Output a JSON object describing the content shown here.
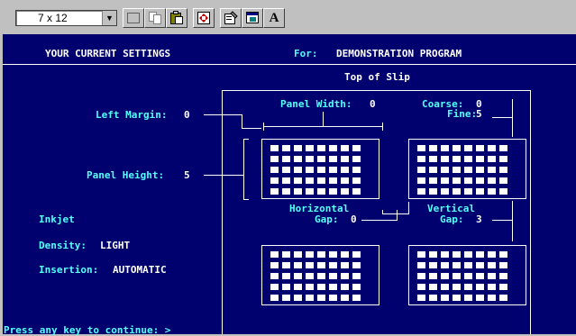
{
  "toolbar": {
    "font_size": "7 x 12",
    "font_button_label": "A"
  },
  "screen": {
    "header_left": "YOUR CURRENT SETTINGS",
    "header_for_label": "For:",
    "header_program": "DEMONSTRATION PROGRAM",
    "top_of_slip": "Top of Slip",
    "left_margin_label": "Left Margin:",
    "left_margin_value": "0",
    "panel_height_label": "Panel Height:",
    "panel_height_value": "5",
    "panel_width_label": "Panel Width:",
    "panel_width_value": "0",
    "coarse_label": "Coarse:",
    "coarse_value": "0",
    "fine_label": "Fine:",
    "fine_value": "5",
    "horizontal_label": "Horizontal",
    "horizontal_gap_label": "Gap:",
    "horizontal_gap_value": "0",
    "vertical_label": "Vertical",
    "vertical_gap_label": "Gap:",
    "vertical_gap_value": "3",
    "printer_type": "Inkjet",
    "density_label": "Density:",
    "density_value": "LIGHT",
    "insertion_label": "Insertion:",
    "insertion_value": "AUTOMATIC",
    "prompt": "Press any key to continue: >"
  },
  "colors": {
    "screen_background": "#00006e",
    "label_cyan": "#55ffff",
    "value_white": "#ffffff"
  }
}
